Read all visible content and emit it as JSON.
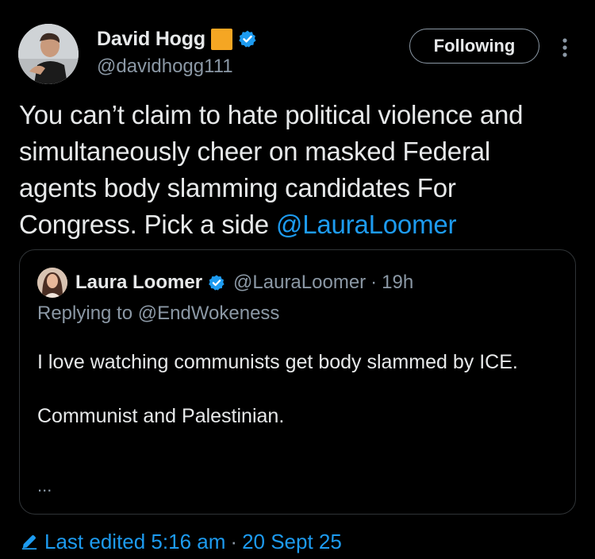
{
  "author": {
    "display_name": "David Hogg",
    "handle": "@davidhogg111",
    "badge_color": "#f5a623",
    "verified": true
  },
  "follow_button": {
    "label": "Following"
  },
  "menu_icon": "more-vertical-icon",
  "tweet": {
    "text": "You can’t claim to hate political violence and simultaneously cheer on masked Federal agents body slamming candidates For Congress. Pick a side ",
    "mention": "@LauraLoomer"
  },
  "quote": {
    "display_name": "Laura Loomer",
    "handle": "@LauraLoomer",
    "separator": "·",
    "time": "19h",
    "replying_to": "Replying to @EndWokeness",
    "line1": "I love watching communists get body slammed by ICE.",
    "line2": "Communist and Palestinian.",
    "ellipsis": "..."
  },
  "footer": {
    "edited_label": "Last edited 5:16 am",
    "separator": "·",
    "date": "20 Sept 25"
  },
  "colors": {
    "background": "#000000",
    "text": "#e7e9ea",
    "secondary": "#8b98a5",
    "link": "#1d9bf0",
    "border": "#2f3336"
  }
}
